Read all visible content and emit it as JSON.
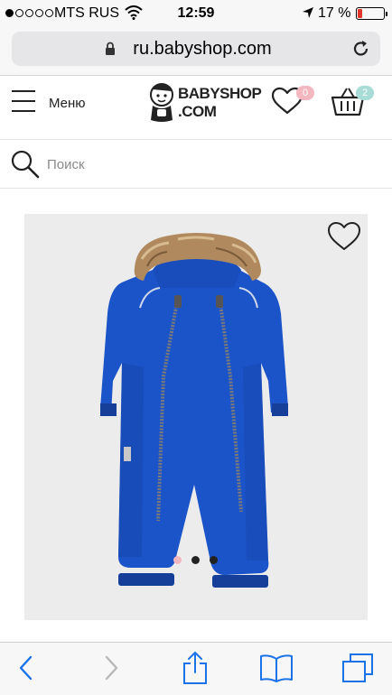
{
  "status_bar": {
    "carrier": "MTS RUS",
    "time": "12:59",
    "battery": "17 %",
    "battery_level": 0.17,
    "signal_bars": 1,
    "signal_total": 5,
    "colors": {
      "battery_low": "#e0352b"
    }
  },
  "browser": {
    "url": "ru.babyshop.com",
    "icons": [
      "lock-icon",
      "reload-icon"
    ]
  },
  "header": {
    "menu_label": "Меню",
    "logo_line1": "BABYSHOP",
    "logo_line2": ".COM",
    "wishlist_count": "0",
    "cart_count": "2",
    "colors": {
      "wishlist_badge": "#f3b7c0",
      "cart_badge": "#a8dcd6"
    }
  },
  "search": {
    "placeholder": "Поиск",
    "value": ""
  },
  "product": {
    "image_dots": 3,
    "active_dot": 0,
    "colors": {
      "suit": "#1b53c9",
      "background": "#ececec"
    }
  },
  "toolbar": {
    "icons": [
      "back-icon",
      "forward-icon",
      "share-icon",
      "bookmarks-icon",
      "tabs-icon"
    ],
    "colors": {
      "active": "#1a73e8",
      "disabled": "#b8b8b8"
    }
  }
}
